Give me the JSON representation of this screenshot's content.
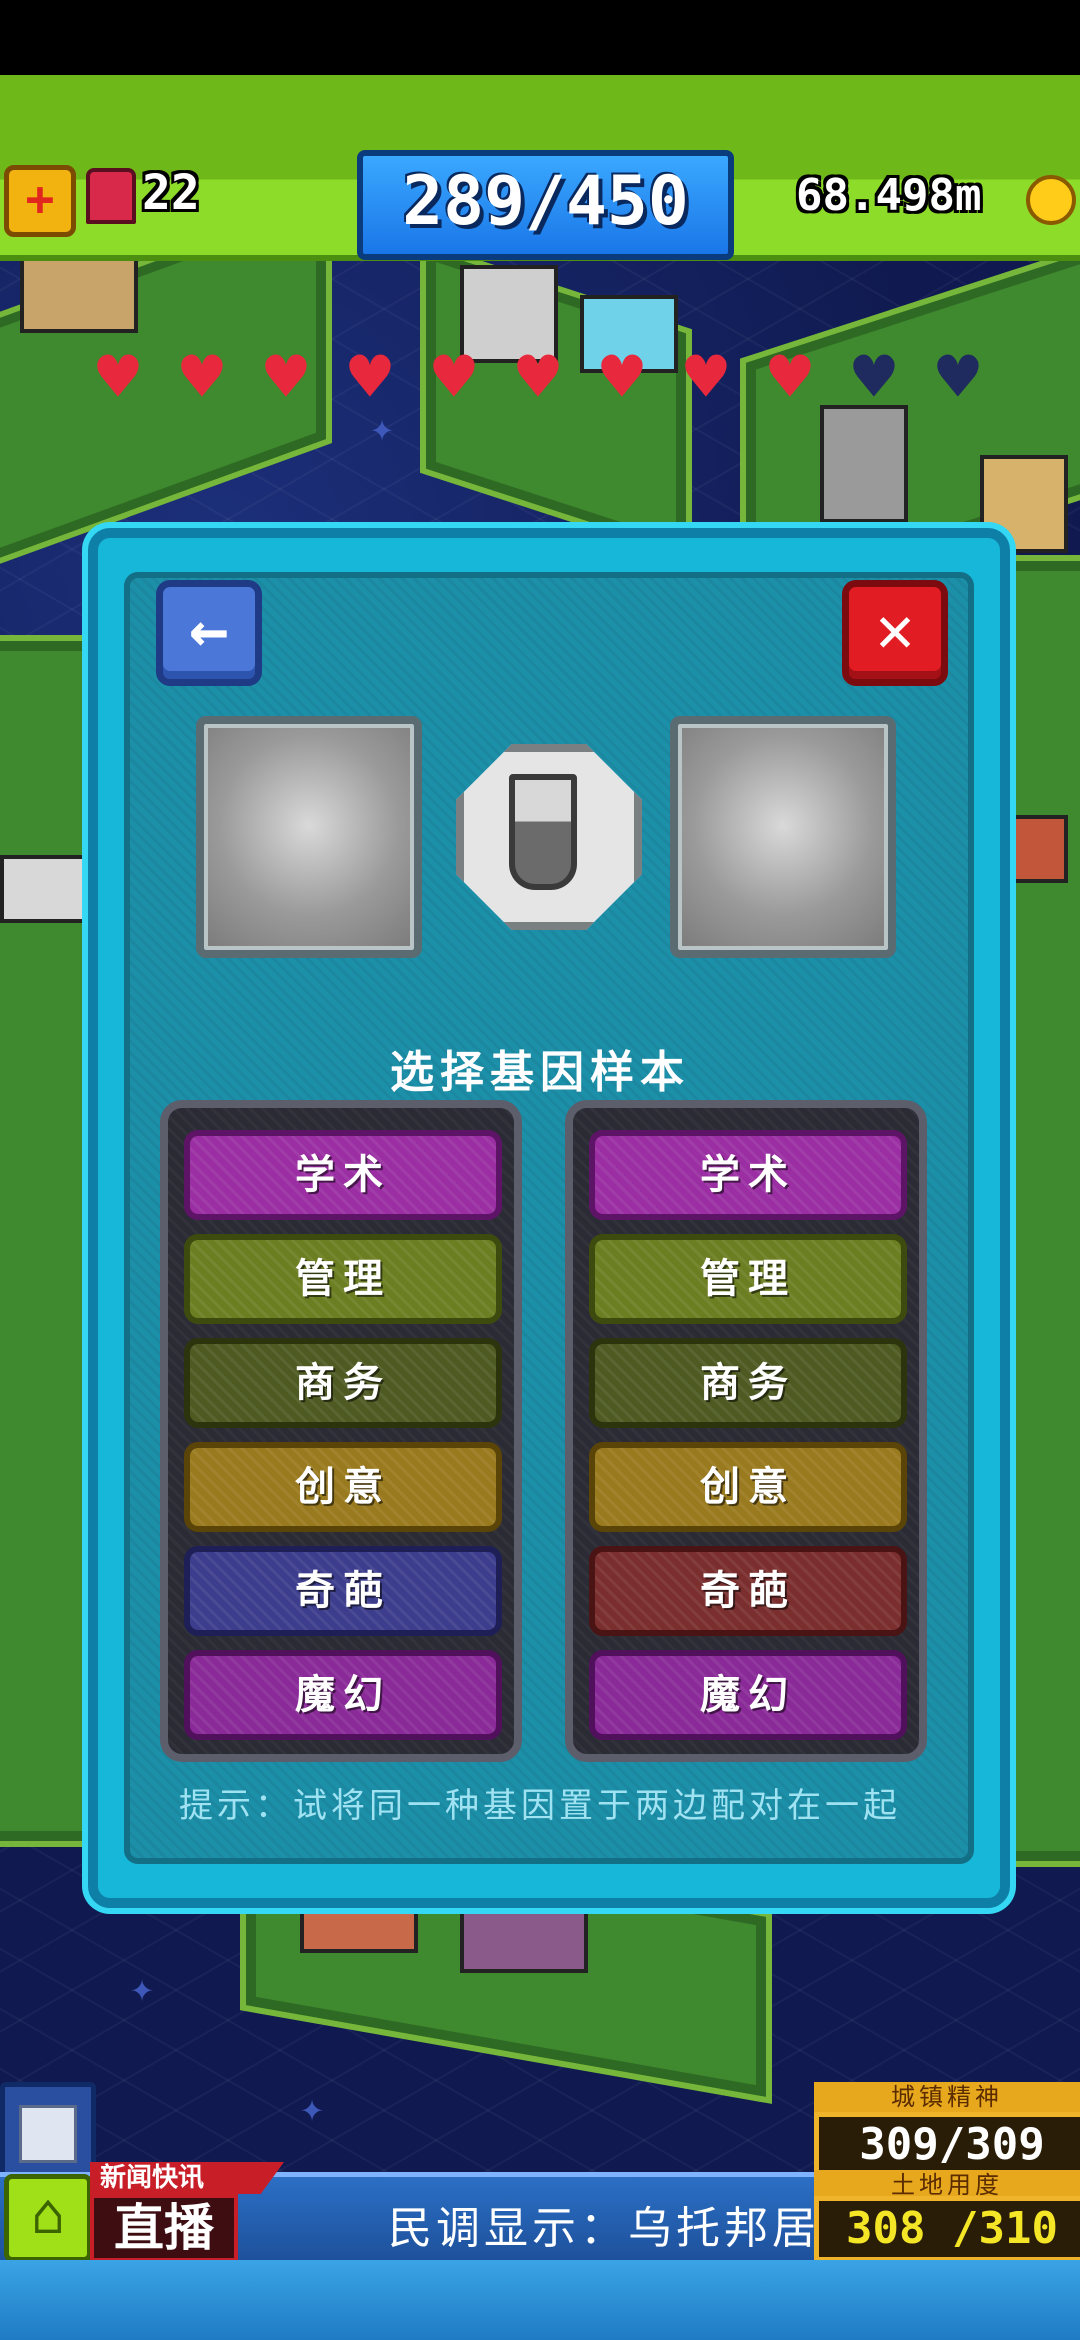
{
  "hud": {
    "plus_icon": "plus-icon",
    "tank_count": "22",
    "population": "289/450",
    "money": "68.498m",
    "coin_icon": "coin-icon"
  },
  "hearts": {
    "filled": 9,
    "total": 11,
    "color_filled": "#e8283c",
    "color_empty": "#1f2a5e"
  },
  "dialog": {
    "back_glyph": "←",
    "close_glyph": "✕",
    "title": "选择基因样本",
    "hint": "提示：试将同一种基因置于两边配对在一起"
  },
  "genes_left": [
    {
      "label": "学术",
      "color": "#9a2ea2",
      "border": "#5e1466"
    },
    {
      "label": "管理",
      "color": "#6c7e22",
      "border": "#3d4b0e"
    },
    {
      "label": "商务",
      "color": "#4e5a22",
      "border": "#2c340e"
    },
    {
      "label": "创意",
      "color": "#9a7a1e",
      "border": "#5a4408"
    },
    {
      "label": "奇葩",
      "color": "#3c3d8c",
      "border": "#1e1f56"
    },
    {
      "label": "魔幻",
      "color": "#8a2a98",
      "border": "#50105c"
    }
  ],
  "genes_right": [
    {
      "label": "学术",
      "color": "#9a2ea2",
      "border": "#5e1466"
    },
    {
      "label": "管理",
      "color": "#6c7e22",
      "border": "#3d4b0e"
    },
    {
      "label": "商务",
      "color": "#4e5a22",
      "border": "#2c340e"
    },
    {
      "label": "创意",
      "color": "#9a7a1e",
      "border": "#5a4408"
    },
    {
      "label": "奇葩",
      "color": "#7a2e2e",
      "border": "#4a1414"
    },
    {
      "label": "魔幻",
      "color": "#8a2a98",
      "border": "#50105c"
    }
  ],
  "bottom": {
    "news_tag": "新闻快讯",
    "live": "直播",
    "ticker": "民调显示：乌托邦居",
    "spirit_label": "城镇精神",
    "spirit_value": "309/309",
    "land_label": "土地用度",
    "land_value": "308 /310",
    "home_icon": "home-icon",
    "calendar_icon": "calendar-icon"
  }
}
